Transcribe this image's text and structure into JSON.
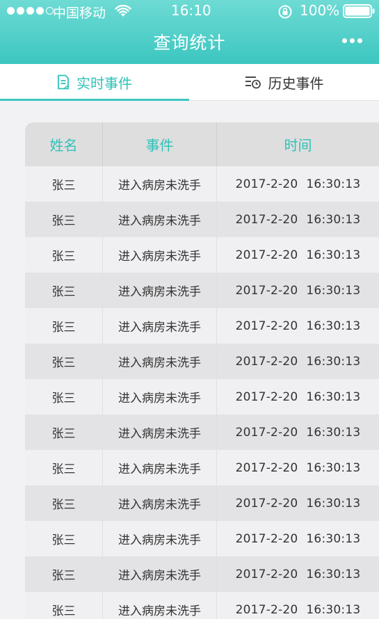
{
  "status_bar": {
    "carrier": "中国移动",
    "time": "16:10",
    "battery": "100%"
  },
  "nav": {
    "title": "查询统计"
  },
  "tabs": [
    {
      "label": "实时事件",
      "active": true,
      "icon": "document-icon"
    },
    {
      "label": "历史事件",
      "active": false,
      "icon": "history-list-icon"
    }
  ],
  "table": {
    "headers": [
      "姓名",
      "事件",
      "时间"
    ],
    "rows": [
      {
        "name": "张三",
        "event": "进入病房未洗手",
        "date": "2017-2-20",
        "time": "16:30:13"
      },
      {
        "name": "张三",
        "event": "进入病房未洗手",
        "date": "2017-2-20",
        "time": "16:30:13"
      },
      {
        "name": "张三",
        "event": "进入病房未洗手",
        "date": "2017-2-20",
        "time": "16:30:13"
      },
      {
        "name": "张三",
        "event": "进入病房未洗手",
        "date": "2017-2-20",
        "time": "16:30:13"
      },
      {
        "name": "张三",
        "event": "进入病房未洗手",
        "date": "2017-2-20",
        "time": "16:30:13"
      },
      {
        "name": "张三",
        "event": "进入病房未洗手",
        "date": "2017-2-20",
        "time": "16:30:13"
      },
      {
        "name": "张三",
        "event": "进入病房未洗手",
        "date": "2017-2-20",
        "time": "16:30:13"
      },
      {
        "name": "张三",
        "event": "进入病房未洗手",
        "date": "2017-2-20",
        "time": "16:30:13"
      },
      {
        "name": "张三",
        "event": "进入病房未洗手",
        "date": "2017-2-20",
        "time": "16:30:13"
      },
      {
        "name": "张三",
        "event": "进入病房未洗手",
        "date": "2017-2-20",
        "time": "16:30:13"
      },
      {
        "name": "张三",
        "event": "进入病房未洗手",
        "date": "2017-2-20",
        "time": "16:30:13"
      },
      {
        "name": "张三",
        "event": "进入病房未洗手",
        "date": "2017-2-20",
        "time": "16:30:13"
      },
      {
        "name": "张三",
        "event": "进入病房未洗手",
        "date": "2017-2-20",
        "time": "16:30:13"
      }
    ]
  },
  "colors": {
    "accent": "#2ec2b8",
    "header_top": "#6edbd4",
    "header_bottom": "#3cc6c0"
  }
}
